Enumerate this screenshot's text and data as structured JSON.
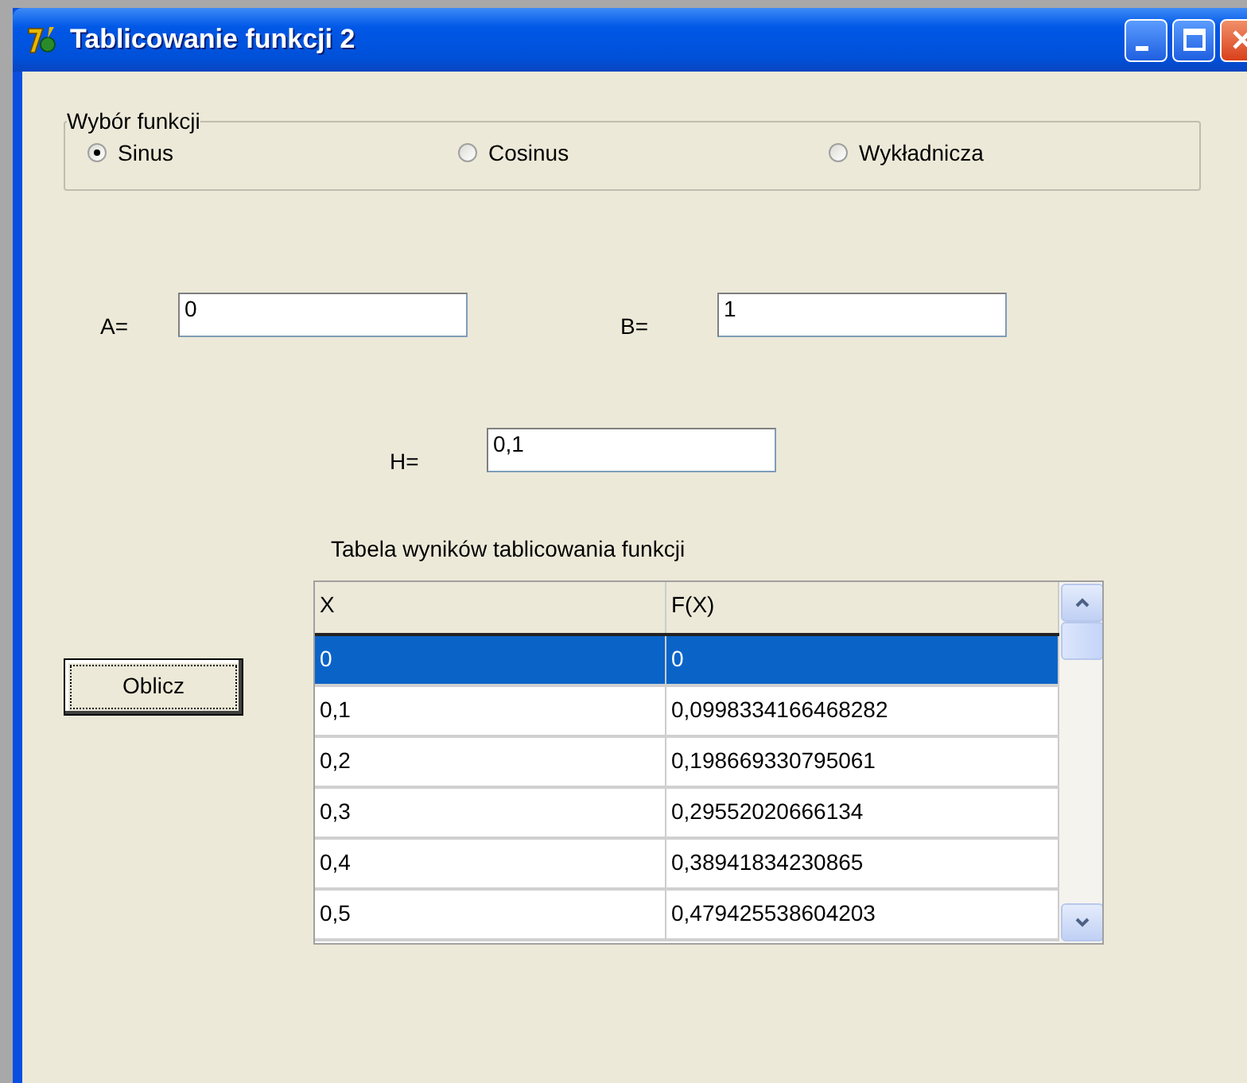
{
  "window": {
    "title": "Tablicowanie funkcji 2"
  },
  "function_group": {
    "label": "Wybór funkcji",
    "options": [
      {
        "label": "Sinus",
        "selected": true
      },
      {
        "label": "Cosinus",
        "selected": false
      },
      {
        "label": "Wykładnicza",
        "selected": false
      }
    ]
  },
  "fields": {
    "a": {
      "label": "A=",
      "value": "0"
    },
    "b": {
      "label": "B=",
      "value": "1"
    },
    "h": {
      "label": "H=",
      "value": "0,1"
    }
  },
  "table": {
    "caption": "Tabela wyników tablicowania funkcji",
    "columns": [
      "X",
      "F(X)"
    ],
    "rows": [
      {
        "cells": [
          "0",
          "0"
        ],
        "selected": true
      },
      {
        "cells": [
          "0,1",
          "0,0998334166468282"
        ],
        "selected": false
      },
      {
        "cells": [
          "0,2",
          "0,198669330795061"
        ],
        "selected": false
      },
      {
        "cells": [
          "0,3",
          "0,29552020666134"
        ],
        "selected": false
      },
      {
        "cells": [
          "0,4",
          "0,38941834230865"
        ],
        "selected": false
      },
      {
        "cells": [
          "0,5",
          "0,479425538604203"
        ],
        "selected": false
      }
    ]
  },
  "buttons": [
    {
      "label": "Oblicz",
      "focused": true
    }
  ]
}
